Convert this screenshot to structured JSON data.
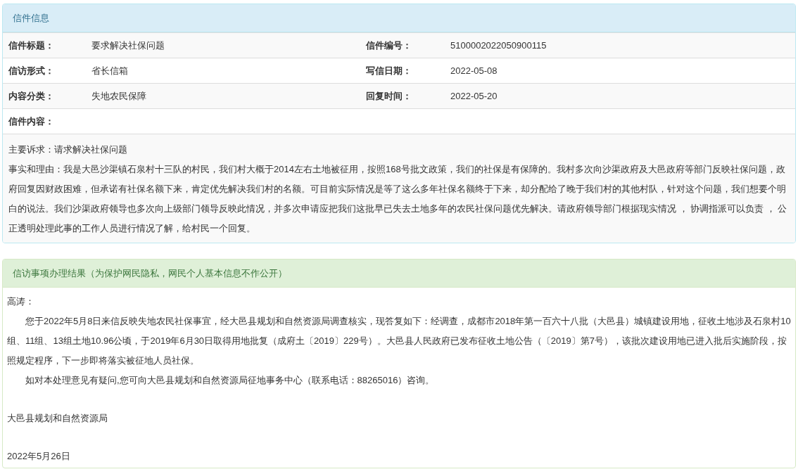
{
  "letter_panel": {
    "title": "信件信息",
    "rows": [
      [
        {
          "label": "信件标题：",
          "value": "要求解决社保问题"
        },
        {
          "label": "信件编号：",
          "value": "5100002022050900115"
        }
      ],
      [
        {
          "label": "信访形式：",
          "value": "省长信箱"
        },
        {
          "label": "写信日期：",
          "value": "2022-05-08"
        }
      ],
      [
        {
          "label": "内容分类：",
          "value": "失地农民保障"
        },
        {
          "label": "回复时间：",
          "value": "2022-05-20"
        }
      ]
    ],
    "content_label": "信件内容：",
    "content": [
      "主要诉求：请求解决社保问题",
      "事实和理由：我是大邑沙渠镇石泉村十三队的村民，我们村大概于2014左右土地被征用，按照168号批文政策，我们的社保是有保障的。我村多次向沙渠政府及大邑政府等部门反映社保问题，政府回复因财政困难，但承诺有社保名额下来，肯定优先解决我们村的名额。可目前实际情况是等了这么多年社保名额终于下来，却分配给了晚于我们村的其他村队，针对这个问题，我们想要个明白的说法。我们沙渠政府领导也多次向上级部门领导反映此情况，并多次申请应把我们这批早已失去土地多年的农民社保问题优先解决。请政府领导部门根据现实情况 ， 协调指派可以负责 ， 公正透明处理此事的工作人员进行情况了解，给村民一个回复。"
    ]
  },
  "reply_panel": {
    "title": "信访事项办理结果（为保护网民隐私，网民个人基本信息不作公开）",
    "greeting": "高涛：",
    "paragraphs": [
      "您于2022年5月8日来信反映失地农民社保事宜，经大邑县规划和自然资源局调查核实，现答复如下：经调查，成都市2018年第一百六十八批（大邑县）城镇建设用地，征收土地涉及石泉村10组、11组、13组土地10.96公顷，于2019年6月30日取得用地批复（成府土〔2019〕229号）。大邑县人民政府已发布征收土地公告（〔2019〕第7号），该批次建设用地已进入批后实施阶段，按照规定程序，下一步即将落实被征地人员社保。",
      "如对本处理意见有疑问,您可向大邑县规划和自然资源局征地事务中心（联系电话：88265016）咨询。"
    ],
    "signature": "大邑县规划和自然资源局",
    "date": "2022年5月26日"
  }
}
